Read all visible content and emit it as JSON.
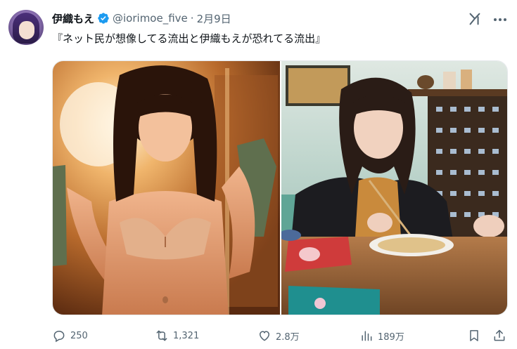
{
  "author": {
    "display_name": "伊織もえ",
    "handle": "@iorimoe_five",
    "separator": "·",
    "date": "2月9日",
    "avatar_icon": "avatar-image",
    "verified_icon": "verified-badge-icon"
  },
  "tweet": {
    "text": "『ネット民が想像してる流出と伊織もえが恐れてる流出』"
  },
  "media": {
    "count": 2,
    "items": [
      "photo-left",
      "photo-right"
    ]
  },
  "actions": {
    "reply_count": "250",
    "retweet_count": "1,321",
    "like_count": "2.8万",
    "view_count": "189万"
  },
  "colors": {
    "text_primary": "#0f1419",
    "text_secondary": "#536471",
    "verified_blue": "#1d9bf0",
    "border": "#e5e8eb"
  }
}
